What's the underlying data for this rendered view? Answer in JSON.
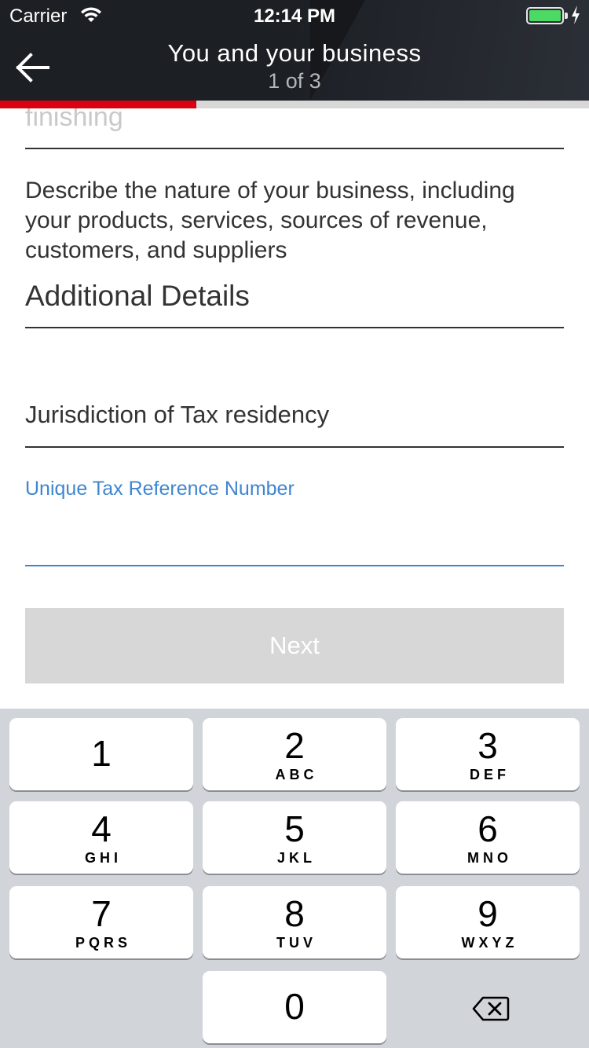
{
  "status_bar": {
    "carrier": "Carrier",
    "time": "12:14 PM",
    "battery_level": 1.0,
    "wifi_icon": "wifi-icon",
    "charging_icon": "bolt-icon"
  },
  "nav": {
    "back_icon": "arrow-left-icon",
    "title": "You and your business",
    "step": "1 of 3",
    "progress_fraction": 0.333
  },
  "form": {
    "previous_field_value": "finishing",
    "describe_prompt": "Describe the nature of your business, including your products, services, sources of revenue, customers, and suppliers",
    "additional_details_value": "Additional Details",
    "jurisdiction_value": "Jurisdiction of Tax residency",
    "tax_reference_label": "Unique Tax Reference Number",
    "tax_reference_value": "",
    "next_label": "Next"
  },
  "keyboard": {
    "keys": [
      {
        "num": "1",
        "letters": ""
      },
      {
        "num": "2",
        "letters": "ABC"
      },
      {
        "num": "3",
        "letters": "DEF"
      },
      {
        "num": "4",
        "letters": "GHI"
      },
      {
        "num": "5",
        "letters": "JKL"
      },
      {
        "num": "6",
        "letters": "MNO"
      },
      {
        "num": "7",
        "letters": "PQRS"
      },
      {
        "num": "8",
        "letters": "TUV"
      },
      {
        "num": "9",
        "letters": "WXYZ"
      },
      {
        "num": "0",
        "letters": ""
      }
    ],
    "delete_icon": "backspace-icon"
  },
  "colors": {
    "header_bg": "#1c1f24",
    "progress_red": "#db0011",
    "focus_blue": "#3f85d0",
    "disabled_button": "#d7d7d7",
    "keyboard_bg": "#d1d4d9"
  }
}
